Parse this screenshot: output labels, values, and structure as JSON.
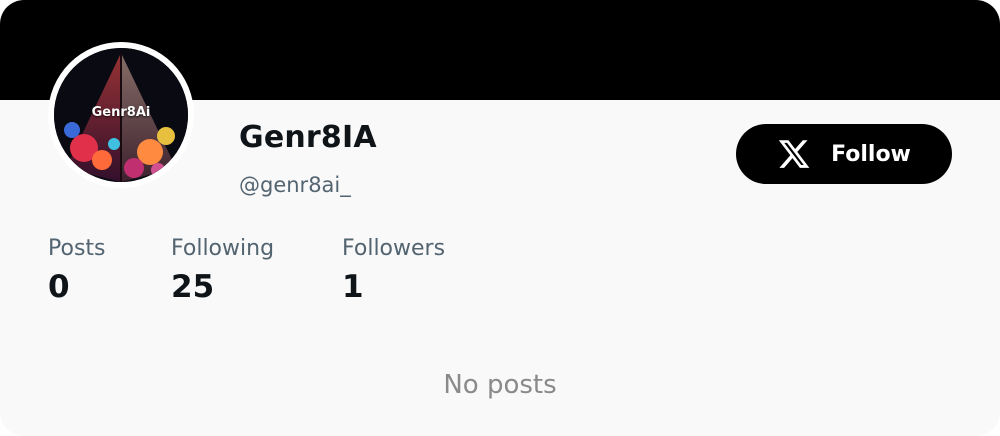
{
  "profile": {
    "avatar_text": "Genr8Ai",
    "name": "Genr8IA",
    "handle": "@genr8ai_"
  },
  "follow_button": {
    "icon": "x-logo-icon",
    "label": "Follow"
  },
  "stats": [
    {
      "label": "Posts",
      "value": "0"
    },
    {
      "label": "Following",
      "value": "25"
    },
    {
      "label": "Followers",
      "value": "1"
    }
  ],
  "empty_state": "No posts",
  "colors": {
    "banner": "#000000",
    "card_background": "#f9f9f9",
    "primary_text": "#0f1419",
    "secondary_text": "#536471",
    "button": "#000000"
  }
}
